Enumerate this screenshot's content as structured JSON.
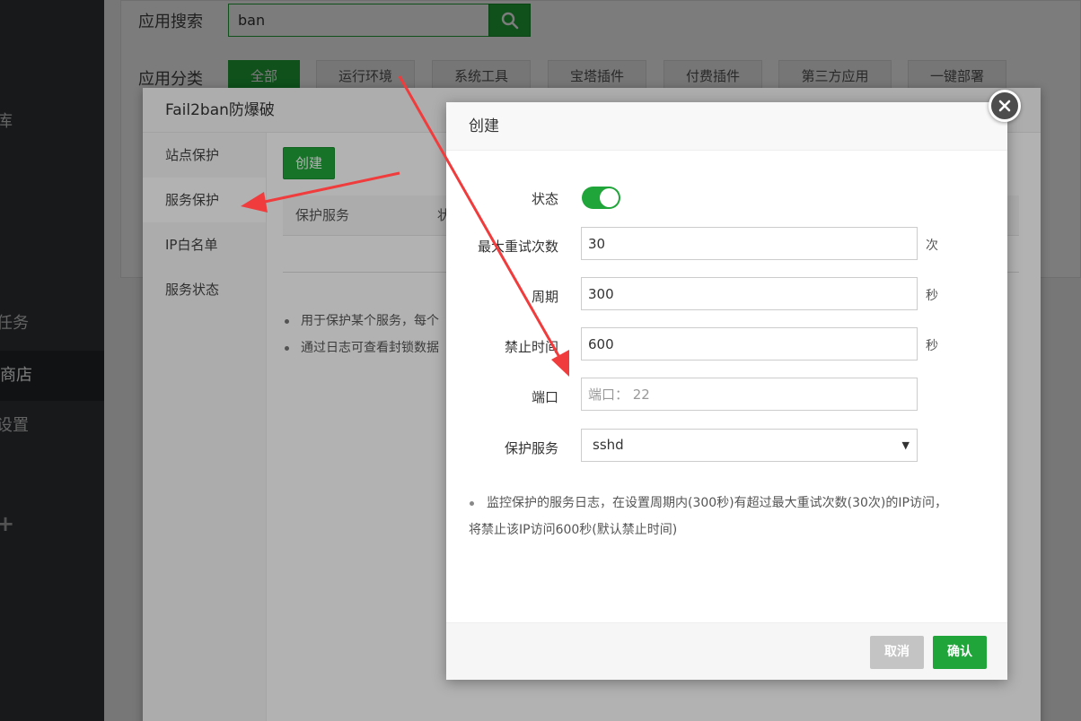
{
  "sidebar": {
    "items": [
      {
        "label": "库"
      },
      {
        "label": "任务"
      },
      {
        "label": "商店"
      },
      {
        "label": "设置"
      }
    ],
    "plus_icon": "plus-icon"
  },
  "search": {
    "label": "应用搜索",
    "value": "ban",
    "button_icon": "search-icon"
  },
  "categories": {
    "label": "应用分类",
    "items": [
      "全部",
      "运行环境",
      "系统工具",
      "宝塔插件",
      "付费插件",
      "第三方应用",
      "一键部署"
    ]
  },
  "panel": {
    "title": "Fail2ban防爆破",
    "nav": [
      "站点保护",
      "服务保护",
      "IP白名单",
      "服务状态"
    ],
    "create_label": "创建",
    "table_headers": [
      "保护服务",
      "状"
    ],
    "tips": [
      "用于保护某个服务，每个",
      "通过日志可查看封锁数据"
    ]
  },
  "dialog": {
    "title": "创建",
    "status_label": "状态",
    "status_on": true,
    "max_retry": {
      "label": "最大重试次数",
      "value": "30",
      "unit": "次"
    },
    "period": {
      "label": "周期",
      "value": "300",
      "unit": "秒"
    },
    "ban_time": {
      "label": "禁止时间",
      "value": "600",
      "unit": "秒"
    },
    "port": {
      "label": "端口",
      "placeholder": "端口： 22",
      "value": ""
    },
    "service": {
      "label": "保护服务",
      "value": "sshd"
    },
    "tip_line1": "监控保护的服务日志，在设置周期内(300秒)有超过最大重试次数(30次)的IP访问，",
    "tip_line2": "将禁止该IP访问600秒(默认禁止时间)",
    "cancel_label": "取消",
    "ok_label": "确认",
    "close_icon": "close-icon"
  },
  "colors": {
    "accent": "#20a53a",
    "sidebar_bg": "#30363a",
    "annotation_arrow": "#f03c3c"
  }
}
